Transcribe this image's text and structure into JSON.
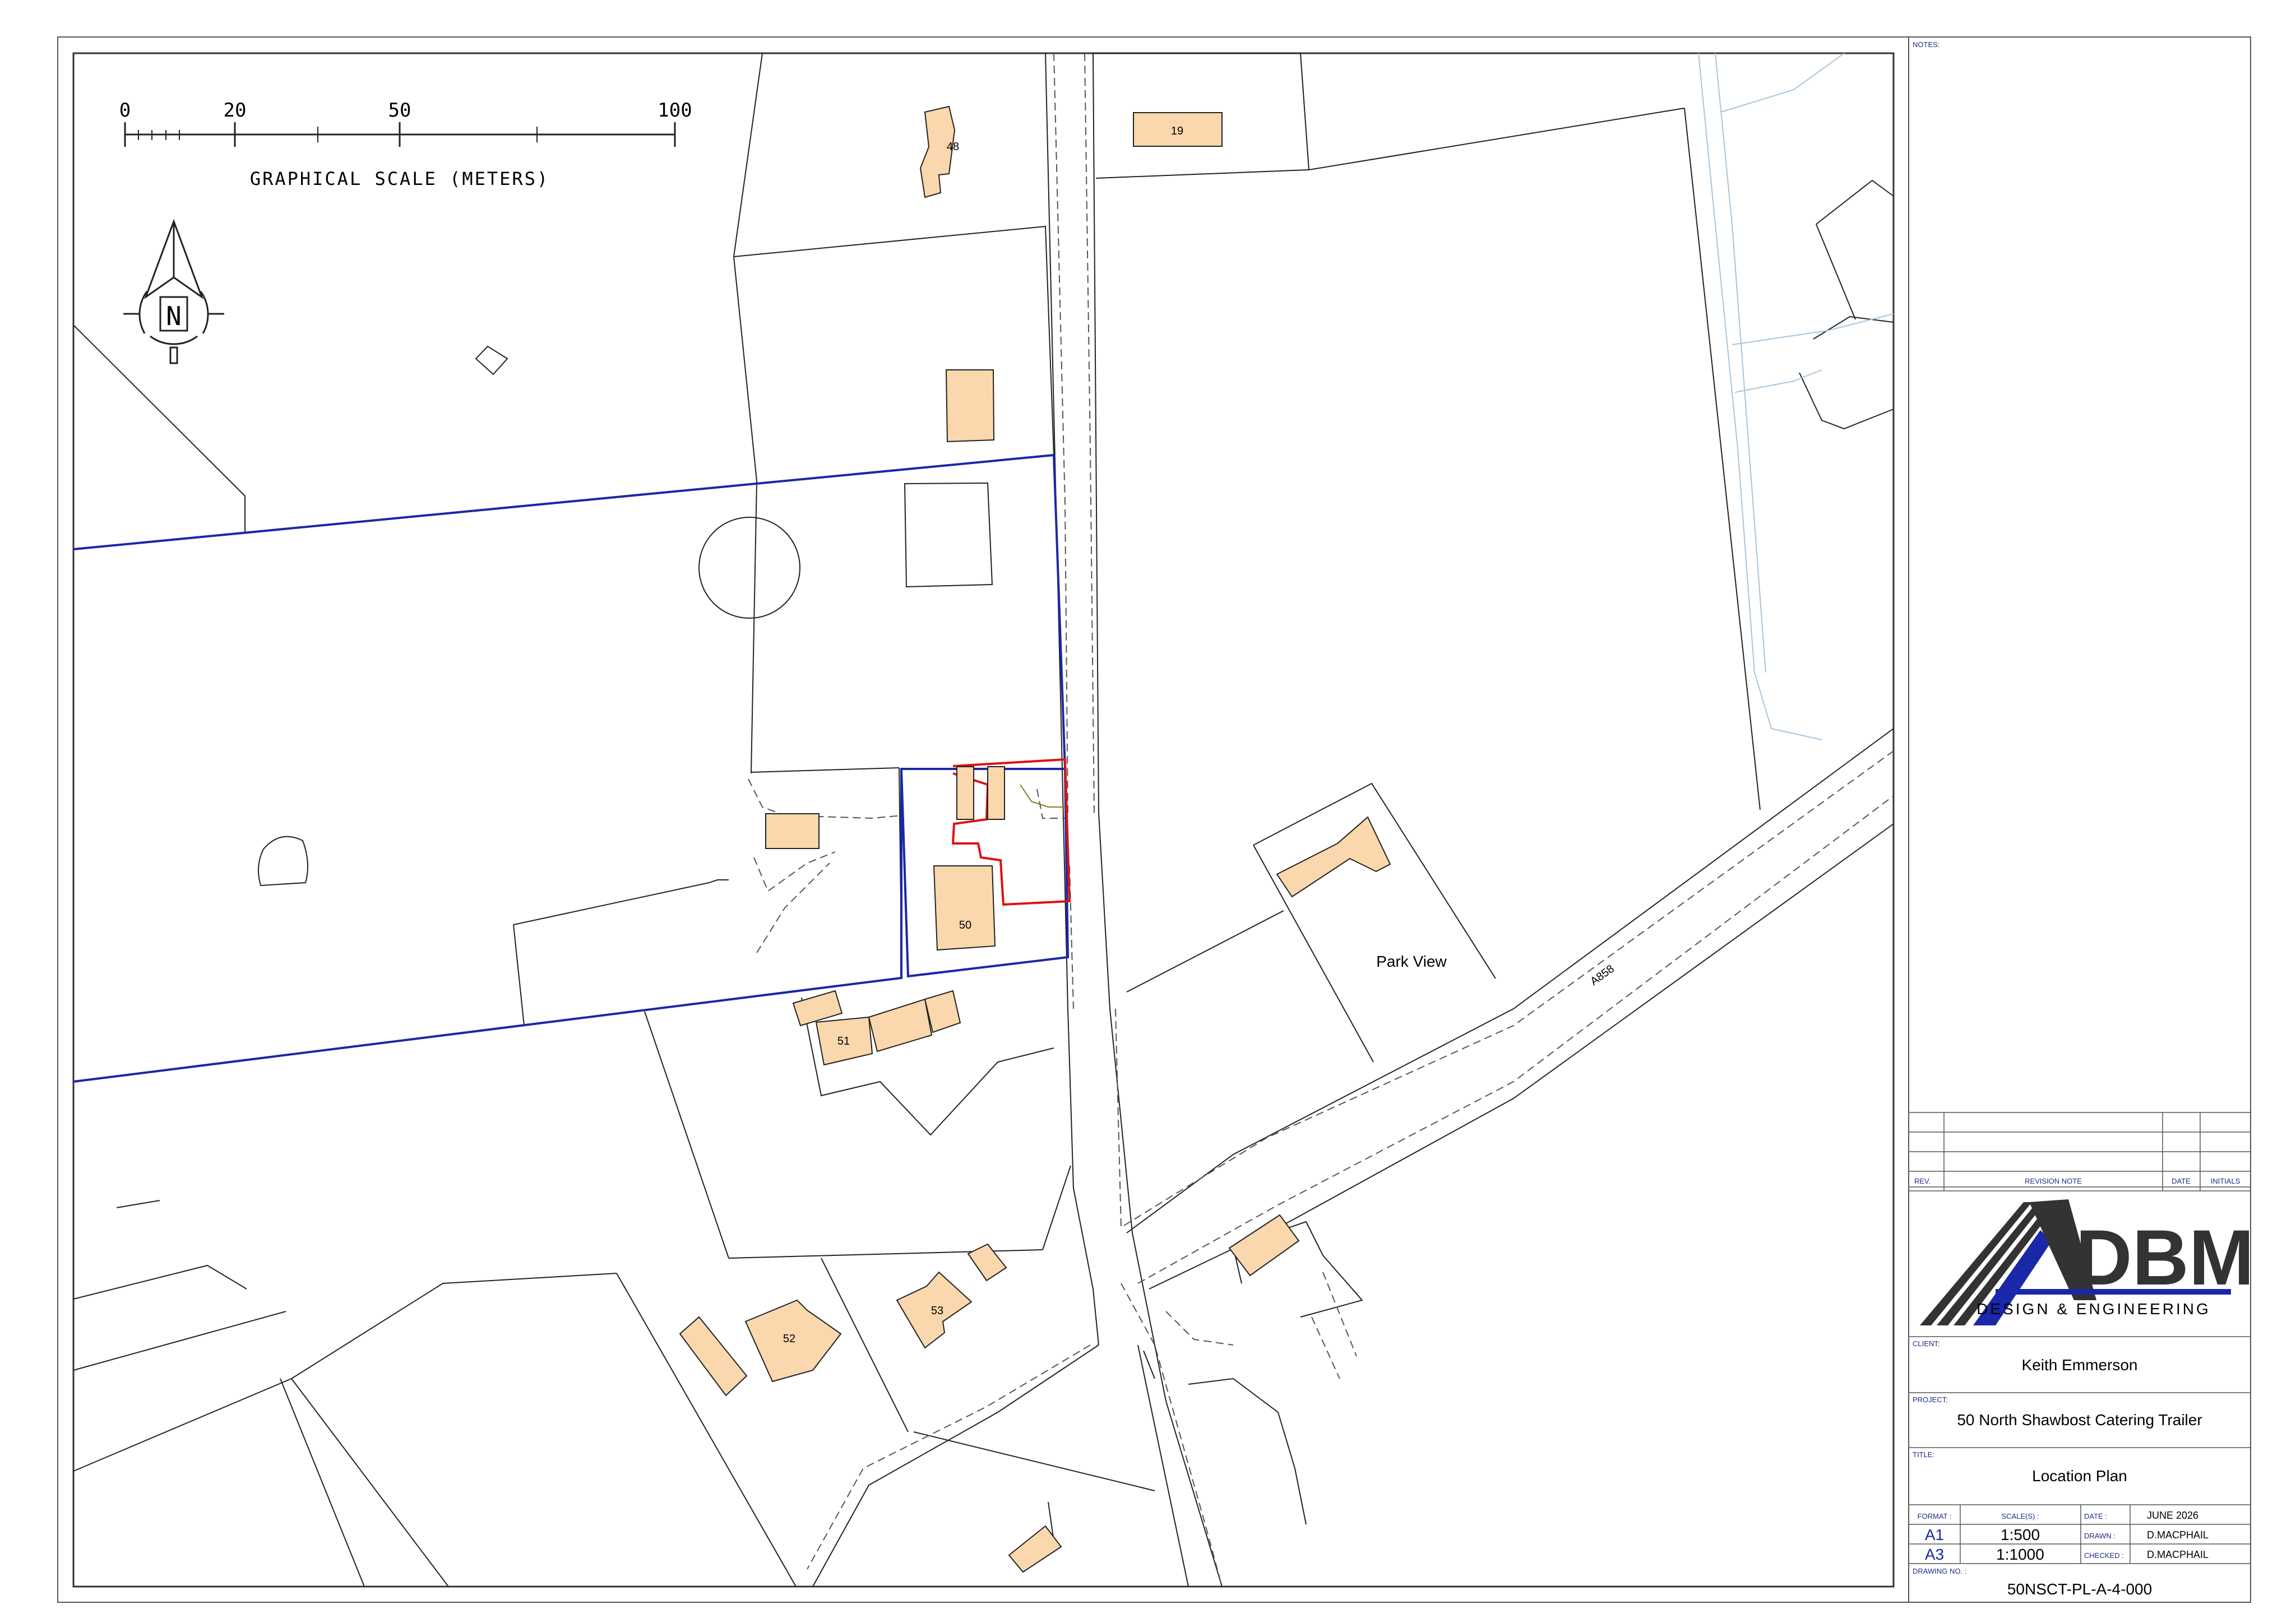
{
  "scale_bar": {
    "ticks": [
      "0",
      "20",
      "50",
      "100"
    ],
    "title": "GRAPHICAL SCALE (METERS)"
  },
  "north_arrow": {
    "letter": "N",
    "icon": "north-arrow-icon"
  },
  "map_labels": {
    "house_48": "48",
    "house_19": "19",
    "house_50": "50",
    "house_51": "51",
    "house_52": "52",
    "house_53": "53",
    "park_view": "Park View",
    "road": "A858"
  },
  "title_block": {
    "notes_label": "NOTES:",
    "revision_headers": {
      "rev": "REV.",
      "note": "REVISION NOTE",
      "date": "DATE",
      "initials": "INITIALS"
    },
    "logo": {
      "brand": "DBM",
      "tagline": "DESIGN & ENGINEERING",
      "accent": "#1a27a8"
    },
    "client_label": "CLIENT:",
    "client": "Keith Emmerson",
    "project_label": "PROJECT:",
    "project": "50 North Shawbost Catering Trailer",
    "title_label": "TITLE:",
    "title": "Location Plan",
    "table": {
      "format_label": "FORMAT :",
      "scales_label": "SCALE(S) :",
      "date_label": "DATE :",
      "date": "JUNE 2026",
      "drawn_label": "DRAWN :",
      "drawn": "D.MACPHAIL",
      "checked_label": "CHECKED :",
      "checked": "D.MACPHAIL",
      "rows": [
        {
          "format": "A1",
          "scale": "1:500"
        },
        {
          "format": "A3",
          "scale": "1:1000"
        }
      ]
    },
    "drawing_no_label": "DRAWING NO. :",
    "drawing_no": "50NSCT-PL-A-4-000"
  },
  "colors": {
    "building_fill": "#fad7ac",
    "site_boundary": "#e01010",
    "ownership_boundary": "#1a27a8",
    "stream": "#a9c4d8"
  }
}
